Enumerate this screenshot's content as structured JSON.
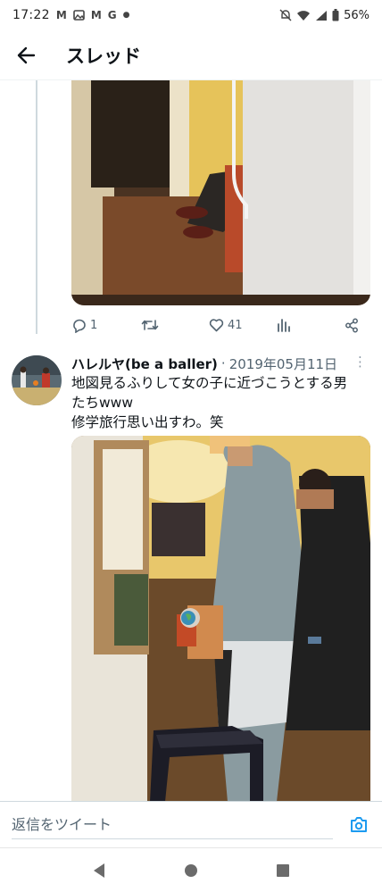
{
  "status_bar": {
    "time": "17:22",
    "notifications": [
      "M",
      "M",
      "G"
    ],
    "battery": "56%"
  },
  "header": {
    "title": "スレッド",
    "back_icon": "arrow-left-icon"
  },
  "prev_tweet": {
    "reply_count": "1",
    "retweet_count": "",
    "like_count": "41"
  },
  "tweet": {
    "author": "ハレルヤ(be a baller)",
    "separator": "·",
    "date": "2019年05月11日",
    "more": "⋮",
    "text_line1": "地図見るふりして女の子に近づこうとする男",
    "text_line2": "たちwww",
    "text_line3": "修学旅行思い出すわ。笑"
  },
  "reply": {
    "placeholder": "返信をツイート",
    "camera_icon": "camera-icon"
  },
  "colors": {
    "accent": "#1d9bf0",
    "text_secondary": "#536471",
    "thread_line": "#cfd9de"
  }
}
